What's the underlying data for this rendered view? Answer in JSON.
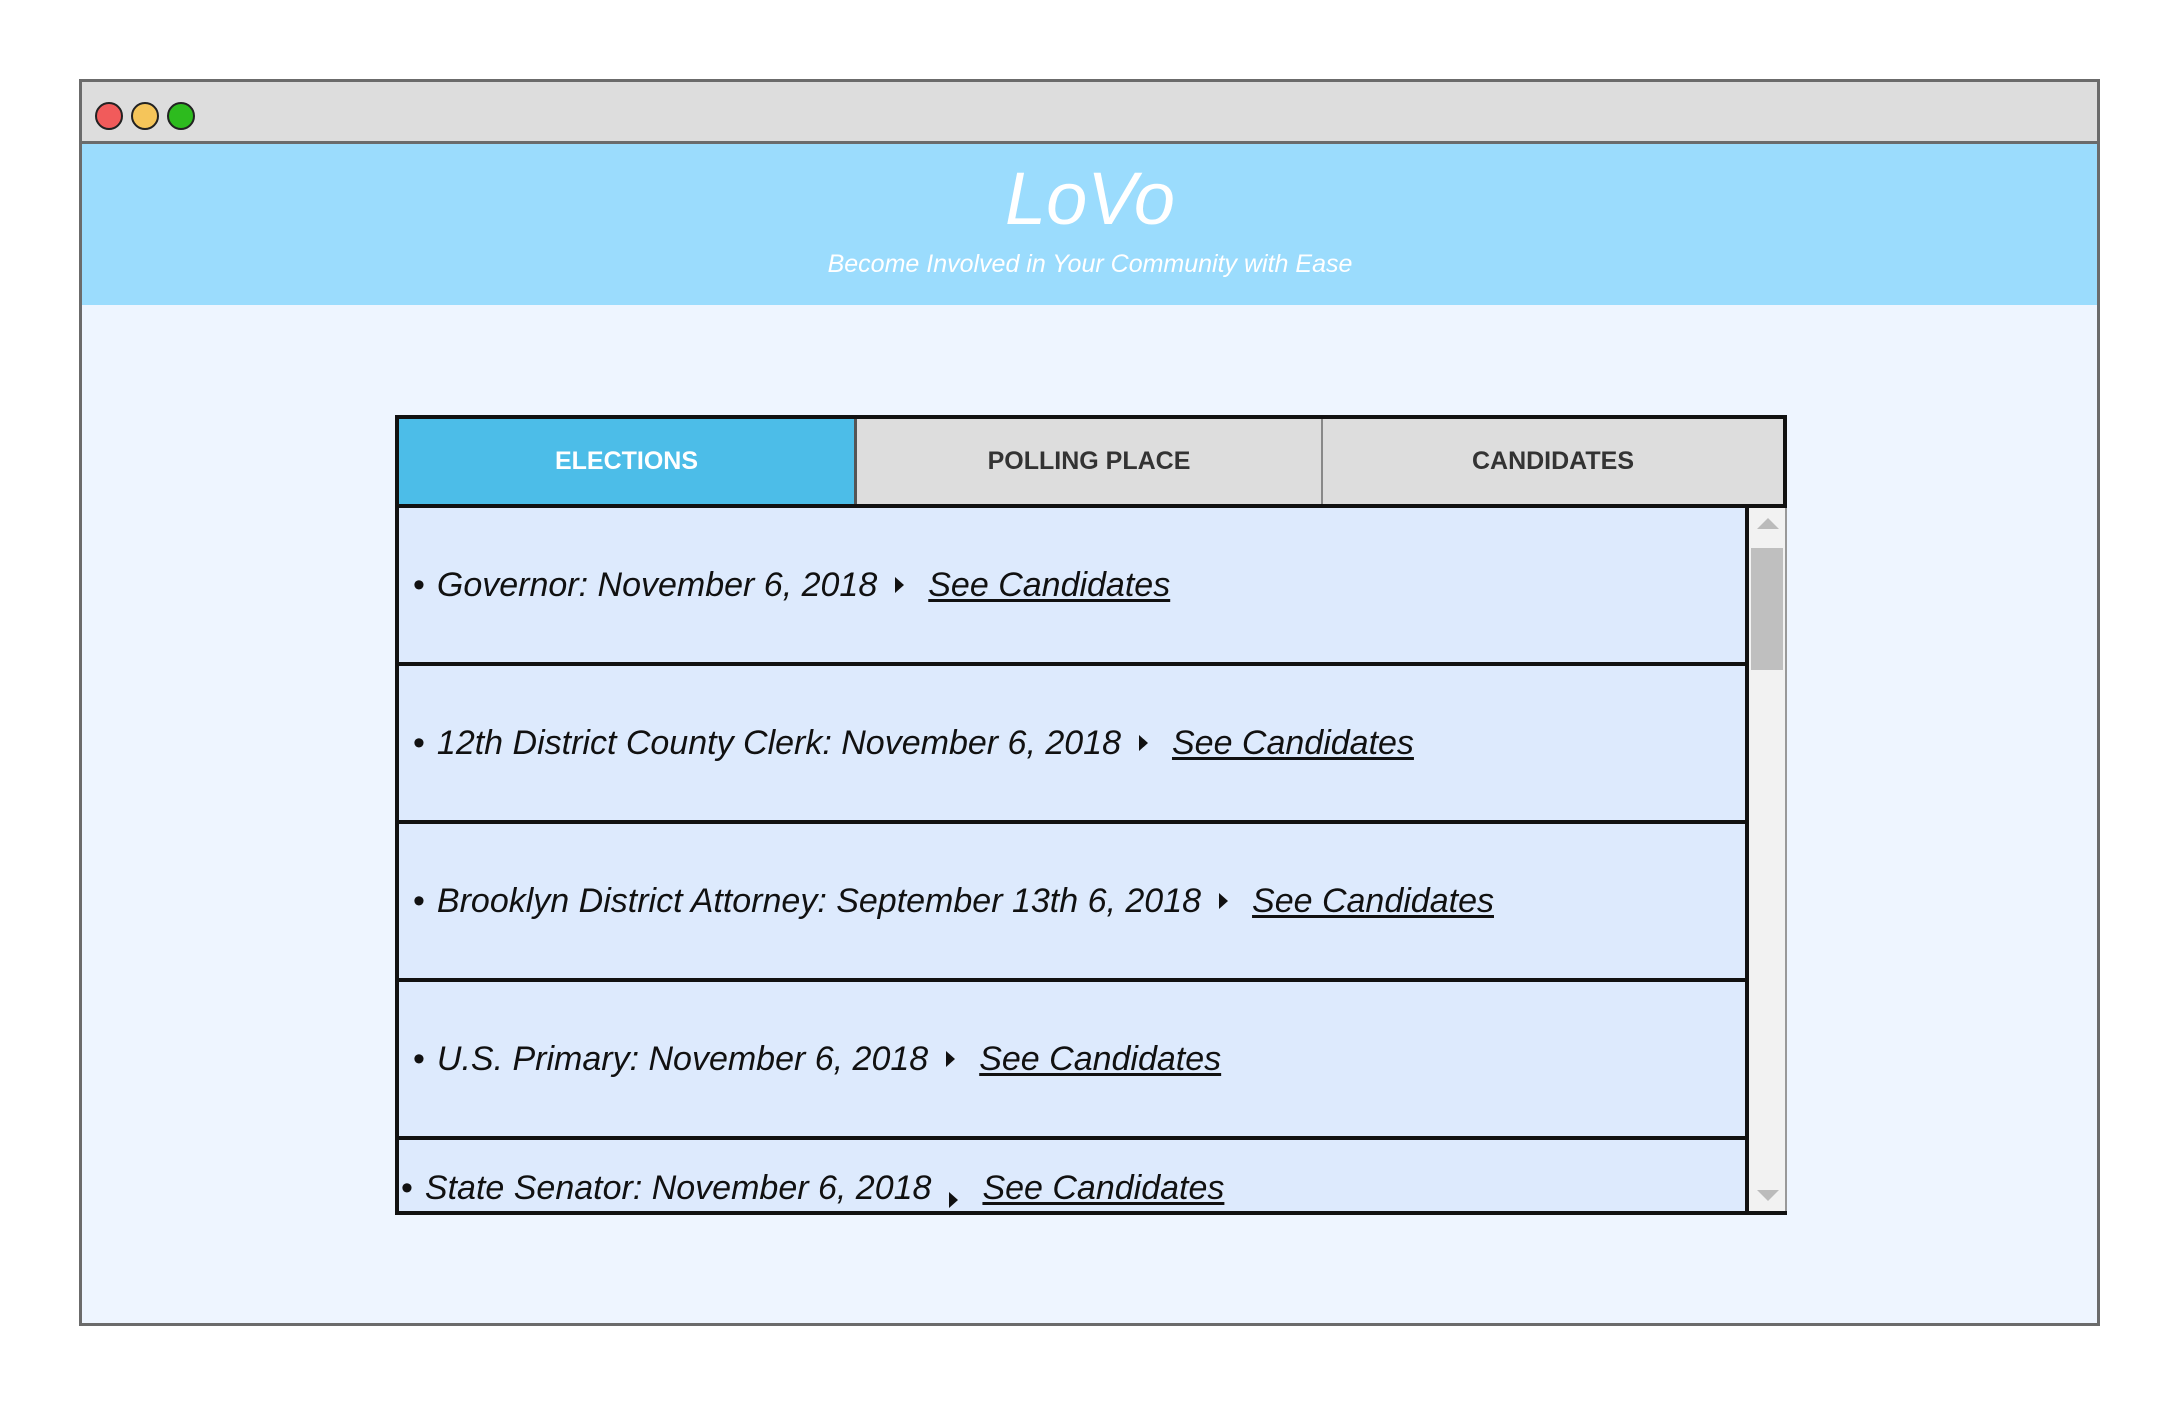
{
  "app": {
    "title": "LoVo",
    "tagline": "Become Involved in Your Community with Ease"
  },
  "tabs": [
    {
      "label": "ELECTIONS",
      "active": true
    },
    {
      "label": "POLLING PLACE",
      "active": false
    },
    {
      "label": "CANDIDATES",
      "active": false
    }
  ],
  "elections": [
    {
      "text": "Governor: November 6, 2018",
      "link": "See Candidates"
    },
    {
      "text": "12th District County Clerk: November 6, 2018",
      "link": "See Candidates"
    },
    {
      "text": "Brooklyn District Attorney: September 13th 6, 2018",
      "link": "See Candidates"
    },
    {
      "text": "U.S. Primary: November 6, 2018",
      "link": "See Candidates"
    },
    {
      "text": "State Senator: November 6, 2018",
      "link": "See Candidates"
    }
  ],
  "bullet": "•",
  "icons": {
    "close": "close-dot-icon",
    "minimize": "minimize-dot-icon",
    "maximize": "maximize-dot-icon",
    "arrow": "caret-right-icon"
  },
  "colors": {
    "header": "#9bdcfd",
    "active_tab": "#4cbde8",
    "list_bg": "#ddeafd",
    "page_bg": "#eef5ff"
  }
}
